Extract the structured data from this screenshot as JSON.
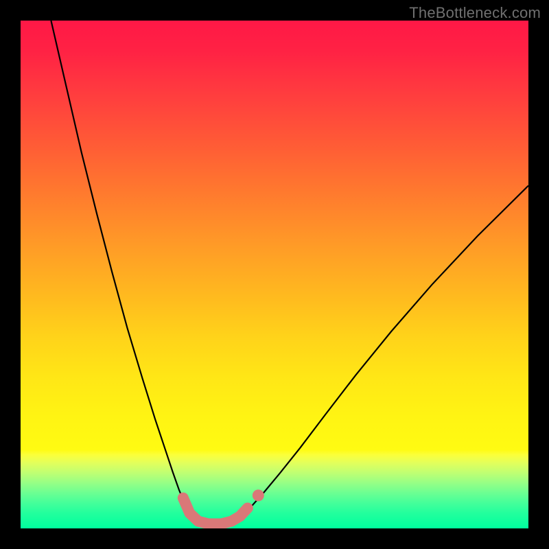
{
  "watermark": "TheBottleneck.com",
  "colors": {
    "background": "#000000",
    "gradient_stops": [
      {
        "offset": 0.0,
        "color": "#ff1846"
      },
      {
        "offset": 0.06,
        "color": "#ff2244"
      },
      {
        "offset": 0.14,
        "color": "#ff3b3f"
      },
      {
        "offset": 0.24,
        "color": "#ff5a36"
      },
      {
        "offset": 0.34,
        "color": "#ff7a2e"
      },
      {
        "offset": 0.44,
        "color": "#ff9a27"
      },
      {
        "offset": 0.54,
        "color": "#ffb91f"
      },
      {
        "offset": 0.62,
        "color": "#ffd21a"
      },
      {
        "offset": 0.7,
        "color": "#ffe616"
      },
      {
        "offset": 0.78,
        "color": "#fff413"
      },
      {
        "offset": 0.845,
        "color": "#fffb12"
      },
      {
        "offset": 0.855,
        "color": "#fbff3a"
      },
      {
        "offset": 0.87,
        "color": "#e4ff5a"
      },
      {
        "offset": 0.89,
        "color": "#c0ff72"
      },
      {
        "offset": 0.91,
        "color": "#97ff85"
      },
      {
        "offset": 0.93,
        "color": "#6cff92"
      },
      {
        "offset": 0.95,
        "color": "#44ff9a"
      },
      {
        "offset": 0.97,
        "color": "#22ff9d"
      },
      {
        "offset": 1.0,
        "color": "#00ff9e"
      }
    ],
    "curve": "#000000",
    "marker": "#da7878"
  },
  "chart_data": {
    "type": "line",
    "title": "",
    "xlabel": "",
    "ylabel": "",
    "xlim": [
      0,
      100
    ],
    "ylim": [
      0,
      100
    ],
    "series": [
      {
        "name": "left-curve",
        "x": [
          6,
          9,
          12,
          15,
          18,
          21,
          24,
          26.5,
          28.5,
          30,
          31.2,
          32.2,
          33,
          33.6,
          34.2,
          34.8
        ],
        "y": [
          100,
          87,
          74,
          62,
          50.5,
          39.5,
          29.5,
          21.5,
          15.5,
          11,
          7.6,
          5.2,
          3.6,
          2.6,
          1.9,
          1.5
        ]
      },
      {
        "name": "flat-segment",
        "x": [
          34.8,
          36,
          37.5,
          39,
          40.5,
          42
        ],
        "y": [
          1.5,
          1.1,
          0.9,
          0.9,
          1.1,
          1.6
        ]
      },
      {
        "name": "right-curve",
        "x": [
          42,
          43.5,
          45.5,
          48,
          51,
          55,
          60,
          66,
          73,
          81,
          90,
          100
        ],
        "y": [
          1.6,
          2.6,
          4.4,
          7.2,
          10.8,
          15.8,
          22.4,
          30.2,
          38.8,
          48.0,
          57.6,
          67.5
        ]
      }
    ],
    "markers": {
      "name": "highlight-region",
      "points": [
        {
          "x": 32.0,
          "y": 6.0
        },
        {
          "x": 33.3,
          "y": 3.0
        },
        {
          "x": 35.0,
          "y": 1.4
        },
        {
          "x": 37.0,
          "y": 0.9
        },
        {
          "x": 39.5,
          "y": 0.9
        },
        {
          "x": 41.5,
          "y": 1.4
        },
        {
          "x": 43.2,
          "y": 2.4
        },
        {
          "x": 44.7,
          "y": 4.0
        }
      ],
      "isolated_dot": {
        "x": 46.8,
        "y": 6.5
      }
    }
  }
}
